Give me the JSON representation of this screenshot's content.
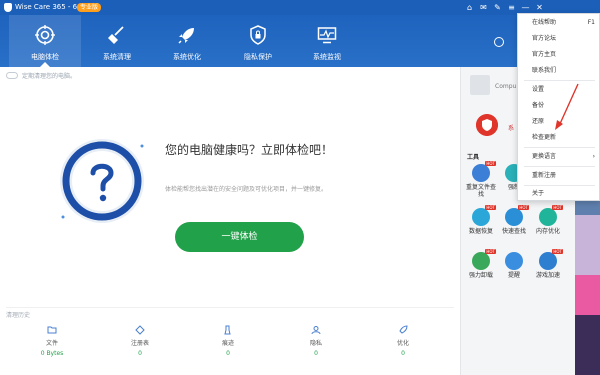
{
  "titlebar": {
    "title": "Wise Care 365 - 6.1.2",
    "badge": "专业版",
    "controls": [
      "⌂",
      "✉",
      "✎",
      "≡",
      "—",
      "✕"
    ]
  },
  "nav": [
    {
      "label": "电脑体检",
      "icon": "health-check-icon"
    },
    {
      "label": "系统清理",
      "icon": "broom-icon"
    },
    {
      "label": "系统优化",
      "icon": "rocket-icon"
    },
    {
      "label": "隐私保护",
      "icon": "lock-icon"
    },
    {
      "label": "系统监视",
      "icon": "monitor-icon"
    }
  ],
  "tip": "定期清理您的电脑。",
  "headline": "您的电脑健康吗？立即体检吧！",
  "subtext": "体检能帮您找出潜在的安全问题及可优化项目，并一键修复。",
  "check_button": "一键体检",
  "clean_section": {
    "title": "清理历史",
    "items": [
      {
        "label": "文件",
        "value": "0 Bytes",
        "icon": "folder-icon"
      },
      {
        "label": "注册表",
        "value": "0",
        "icon": "registry-icon"
      },
      {
        "label": "痕迹",
        "value": "0",
        "icon": "brush-icon"
      },
      {
        "label": "隐私",
        "value": "0",
        "icon": "privacy-icon"
      },
      {
        "label": "优化",
        "value": "0",
        "icon": "rocket-small-icon"
      }
    ]
  },
  "right_panel": {
    "computer_name": "Compu",
    "shield_label": "系",
    "tools_title": "工具",
    "tools": [
      {
        "label": "重复文件查找",
        "color": "#3b7fd6",
        "hot": "HOT"
      },
      {
        "label": "强制",
        "color": "#2ab0b8",
        "hot": ""
      },
      {
        "label": "数据恢复",
        "color": "#2aa7d8",
        "hot": "HOT"
      },
      {
        "label": "快速查找",
        "color": "#2a8fd6",
        "hot": "HOT"
      },
      {
        "label": "内存优化",
        "color": "#20b59a",
        "hot": "HOT"
      },
      {
        "label": "强力卸载",
        "color": "#3aa85a",
        "hot": "HOT"
      },
      {
        "label": "提醒",
        "color": "#3a8ee0",
        "hot": ""
      },
      {
        "label": "游戏加速",
        "color": "#2f7fd1",
        "hot": "HOT"
      }
    ]
  },
  "menu": {
    "items": [
      {
        "label": "在线帮助",
        "key": "F1"
      },
      {
        "label": "官方论坛",
        "key": ""
      },
      {
        "label": "官方主页",
        "key": ""
      },
      {
        "label": "联系我们",
        "key": ""
      },
      {
        "label": "设置",
        "key": ""
      },
      {
        "label": "备份",
        "key": ""
      },
      {
        "label": "还原",
        "key": ""
      },
      {
        "label": "检查更新",
        "key": ""
      },
      {
        "label": "更换语言",
        "key": "›"
      },
      {
        "label": "重新注册",
        "key": ""
      },
      {
        "label": "关于",
        "key": ""
      }
    ]
  },
  "colors": {
    "header": "#1e63bd",
    "accent_green": "#21a14a",
    "menu_arrow": "#e0352b"
  }
}
